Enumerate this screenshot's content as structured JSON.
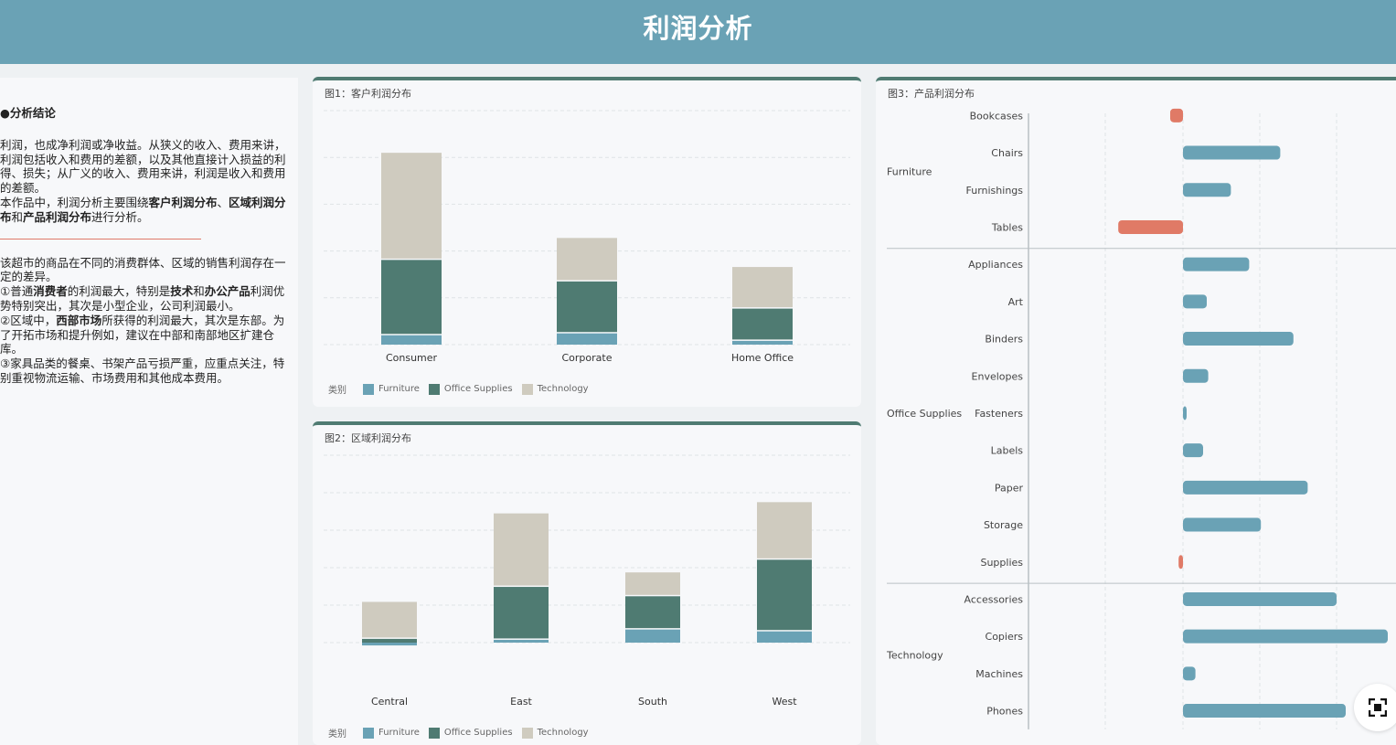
{
  "header": {
    "title": "利润分析"
  },
  "left": {
    "conclusion_title": "●分析结论",
    "p1": "利润，也成净利润或净收益。从狭义的收入、费用来讲，利润包括收入和费用的差额，以及其他直接计入损益的利得、损失；从广义的收入、费用来讲，利润是收入和费用的差额。",
    "p2_parts": [
      "本作品中，利润分析主要围绕",
      "客户利润分布",
      "、",
      "区域利润分布",
      "和",
      "产品利润分布",
      "进行分析。"
    ],
    "p3": "该超市的商品在不同的消费群体、区域的销售利润存在一定的差异。",
    "p4_parts": [
      "①普通",
      "消费者",
      "的利润最大，特别是",
      "技术",
      "和",
      "办公产品",
      "利润优势特别突出，其次是小型企业，公司利润最小。"
    ],
    "p5_parts": [
      "②区域中，",
      "西部市场",
      "所获得的利润最大，其次是东部。为了开拓市场和提升例如，建议在中部和南部地区扩建仓库。"
    ],
    "p6": "③家具品类的餐桌、书架产品亏损严重，应重点关注，特别重视物流运输、市场费用和其他成本费用。"
  },
  "colors": {
    "furniture": "#6aa2b5",
    "office_supplies": "#4f7b72",
    "technology": "#cfcbbf",
    "negative": "#e07a66"
  },
  "fig1": {
    "title": "图1：客户利润分布",
    "legend": {
      "title": "类别",
      "items": [
        "Furniture",
        "Office Supplies",
        "Technology"
      ]
    }
  },
  "fig2": {
    "title": "图2：区域利润分布",
    "legend": {
      "title": "类别",
      "items": [
        "Furniture",
        "Office Supplies",
        "Technology"
      ]
    }
  },
  "fig3": {
    "title": "图3：产品利润分布"
  },
  "chart_data": [
    {
      "type": "bar",
      "stacked": true,
      "categories": [
        "Consumer",
        "Corporate",
        "Home Office"
      ],
      "series": [
        {
          "name": "Furniture",
          "values": [
            10,
            12,
            4
          ]
        },
        {
          "name": "Office Supplies",
          "values": [
            79,
            54,
            33
          ]
        },
        {
          "name": "Technology",
          "values": [
            113,
            45,
            43
          ]
        }
      ],
      "ylim": [
        0,
        250
      ],
      "grid": true,
      "legend": "bottom-left"
    },
    {
      "type": "bar",
      "stacked": true,
      "categories": [
        "Central",
        "East",
        "South",
        "West"
      ],
      "series": [
        {
          "name": "Furniture",
          "values": [
            -3,
            3,
            14,
            12
          ]
        },
        {
          "name": "Office Supplies",
          "values": [
            4,
            55,
            34,
            75
          ]
        },
        {
          "name": "Technology",
          "values": [
            38,
            77,
            24,
            60
          ]
        }
      ],
      "ylim": [
        0,
        200
      ],
      "grid": true,
      "legend": "bottom-left"
    },
    {
      "type": "bar",
      "orientation": "horizontal",
      "groups": [
        {
          "name": "Furniture",
          "items": [
            {
              "label": "Bookcases",
              "value": -3.5
            },
            {
              "label": "Chairs",
              "value": 26.6
            },
            {
              "label": "Furnishings",
              "value": 13.1
            },
            {
              "label": "Tables",
              "value": -17.7
            }
          ]
        },
        {
          "name": "Office Supplies",
          "items": [
            {
              "label": "Appliances",
              "value": 18.1
            },
            {
              "label": "Art",
              "value": 6.5
            },
            {
              "label": "Binders",
              "value": 30.2
            },
            {
              "label": "Envelopes",
              "value": 6.9
            },
            {
              "label": "Fasteners",
              "value": 0.9
            },
            {
              "label": "Labels",
              "value": 5.5
            },
            {
              "label": "Paper",
              "value": 34.1
            },
            {
              "label": "Storage",
              "value": 21.3
            },
            {
              "label": "Supplies",
              "value": -1.2
            }
          ]
        },
        {
          "name": "Technology",
          "items": [
            {
              "label": "Accessories",
              "value": 42.0
            },
            {
              "label": "Copiers",
              "value": 56.0
            },
            {
              "label": "Machines",
              "value": 3.4
            },
            {
              "label": "Phones",
              "value": 44.5
            }
          ]
        }
      ],
      "grid": true
    }
  ]
}
